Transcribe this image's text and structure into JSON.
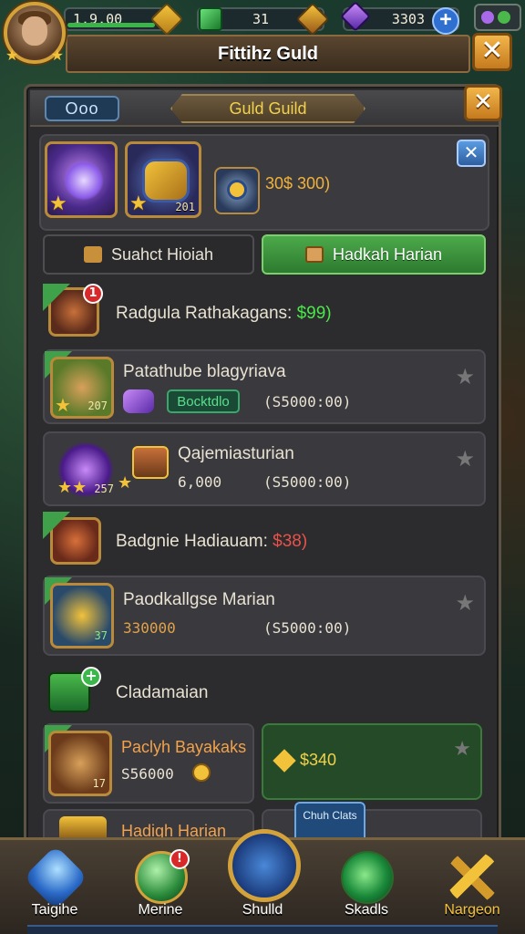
{
  "topbar": {
    "energy_value": "1.9.00",
    "coins_value": "31",
    "gems_value": "3303",
    "plus_label": "+"
  },
  "title": "Fittihz Guld",
  "close_label": "✕",
  "panel": {
    "tab_pill": "Ooo",
    "guild_banner": "Guld Guild",
    "close_label": "✕",
    "top_price": "30$ 300)",
    "top_card_level": "201",
    "tabs": [
      {
        "label": "Suahct Hioiah",
        "active": false
      },
      {
        "label": "Hadkah Harian",
        "active": true
      }
    ],
    "rows": [
      {
        "title": "Radgula Rathakagans:",
        "price": "$99)",
        "type": "header"
      },
      {
        "title": "Patathube blagyriava",
        "button": "Bocktdlo",
        "value": "(S5000:00)",
        "level": "207",
        "type": "item"
      },
      {
        "title": "Qajemiasturian",
        "price": "6,000",
        "value": "(S5000:00)",
        "level": "257",
        "type": "item"
      },
      {
        "title": "Badgnie Hadiauam:",
        "price": "$38)",
        "type": "header"
      },
      {
        "title": "Paodkallgse Marian",
        "price": "330000",
        "value": "(S5000:00)",
        "level": "37",
        "type": "item"
      },
      {
        "title": "Cladamaian",
        "type": "header"
      },
      {
        "title": "Paclyh Bayakaks",
        "price": "S56000",
        "level": "17",
        "type": "item"
      },
      {
        "price": "$340",
        "type": "buy"
      },
      {
        "title": "Hadigh Harian",
        "type": "item"
      }
    ],
    "popup_text": "Chuh Clats"
  },
  "bottom_nav": [
    {
      "label": "Taigihe",
      "color": "#3a8ad8"
    },
    {
      "label": "Merine",
      "color": "#3aa84a",
      "badge": "!"
    },
    {
      "label": "Shulld",
      "color": "#4a9ae8"
    },
    {
      "label": "Skadls",
      "color": "#2faa4a"
    },
    {
      "label": "Nargeon",
      "color": "#d4a23a"
    }
  ],
  "colors": {
    "accent_gold": "#d4a23a",
    "active_tab": "#3fa24a",
    "price_red": "#e8524a",
    "panel_bg": "#2c2b2d"
  }
}
